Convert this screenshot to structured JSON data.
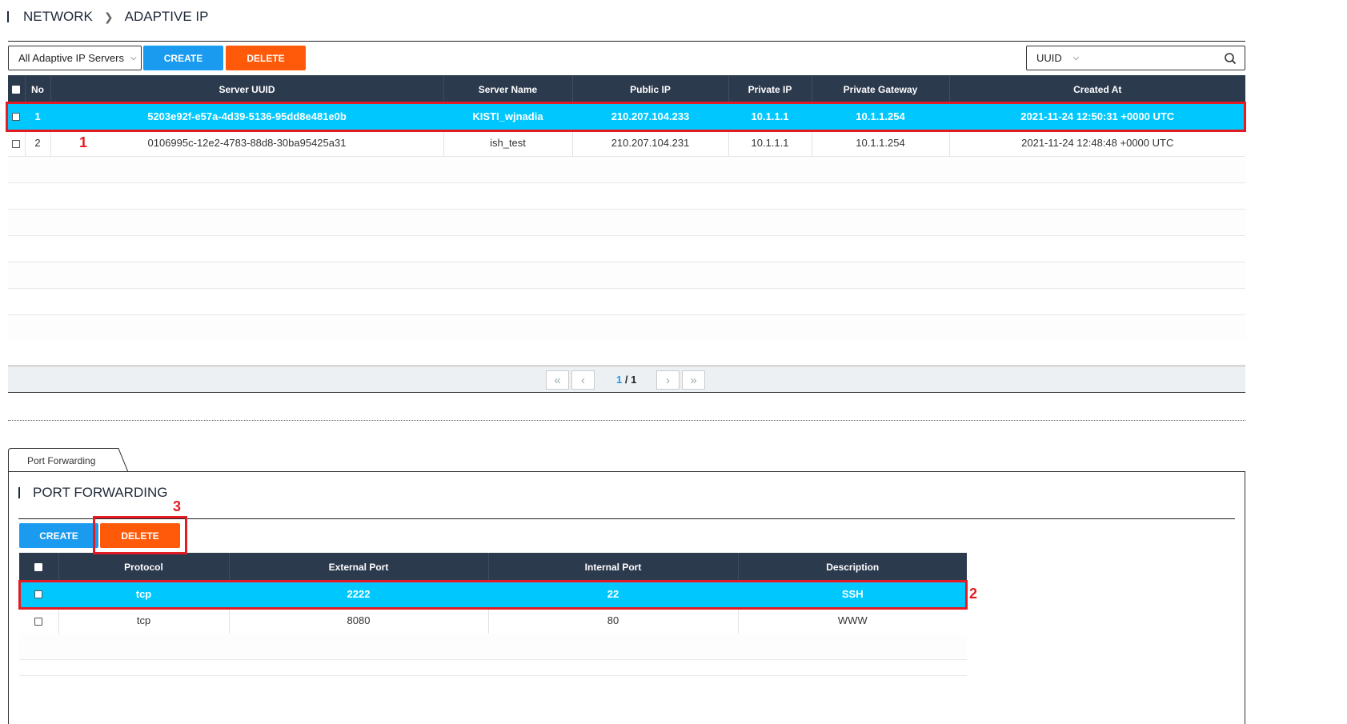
{
  "breadcrumb": {
    "parent": "NETWORK",
    "current": "ADAPTIVE IP"
  },
  "toolbar": {
    "filter_value": "All Adaptive IP Servers",
    "create_label": "CREATE",
    "delete_label": "DELETE",
    "search_field": "UUID",
    "search_value": ""
  },
  "servers": {
    "columns": [
      "No",
      "Server UUID",
      "Server Name",
      "Public IP",
      "Private IP",
      "Private Gateway",
      "Created At"
    ],
    "rows": [
      {
        "no": "1",
        "uuid": "5203e92f-e57a-4d39-5136-95dd8e481e0b",
        "name": "KISTI_wjnadia",
        "public_ip": "210.207.104.233",
        "private_ip": "10.1.1.1",
        "gateway": "10.1.1.254",
        "created": "2021-11-24 12:50:31 +0000 UTC",
        "selected": true
      },
      {
        "no": "2",
        "uuid": "0106995c-12e2-4783-88d8-30ba95425a31",
        "name": "ish_test",
        "public_ip": "210.207.104.231",
        "private_ip": "10.1.1.1",
        "gateway": "10.1.1.254",
        "created": "2021-11-24 12:48:48 +0000 UTC",
        "selected": false
      }
    ]
  },
  "pagination": {
    "current": "1",
    "separator": " / ",
    "total": "1"
  },
  "tabs": [
    {
      "label": "Port Forwarding",
      "active": true
    }
  ],
  "port_forwarding": {
    "title": "PORT FORWARDING",
    "create_label": "CREATE",
    "delete_label": "DELETE",
    "columns": [
      "Protocol",
      "External Port",
      "Internal Port",
      "Description"
    ],
    "rows": [
      {
        "protocol": "tcp",
        "external": "2222",
        "internal": "22",
        "description": "SSH",
        "selected": true
      },
      {
        "protocol": "tcp",
        "external": "8080",
        "internal": "80",
        "description": "WWW",
        "selected": false
      }
    ]
  },
  "annotations": {
    "label_1": "1",
    "label_2": "2",
    "label_3": "3",
    "color": "#e31b23"
  },
  "colors": {
    "accent_blue": "#1a9bf0",
    "accent_orange": "#ff5a0a",
    "selected_row": "#00c8ff",
    "header_bg": "#2c3a4e"
  }
}
